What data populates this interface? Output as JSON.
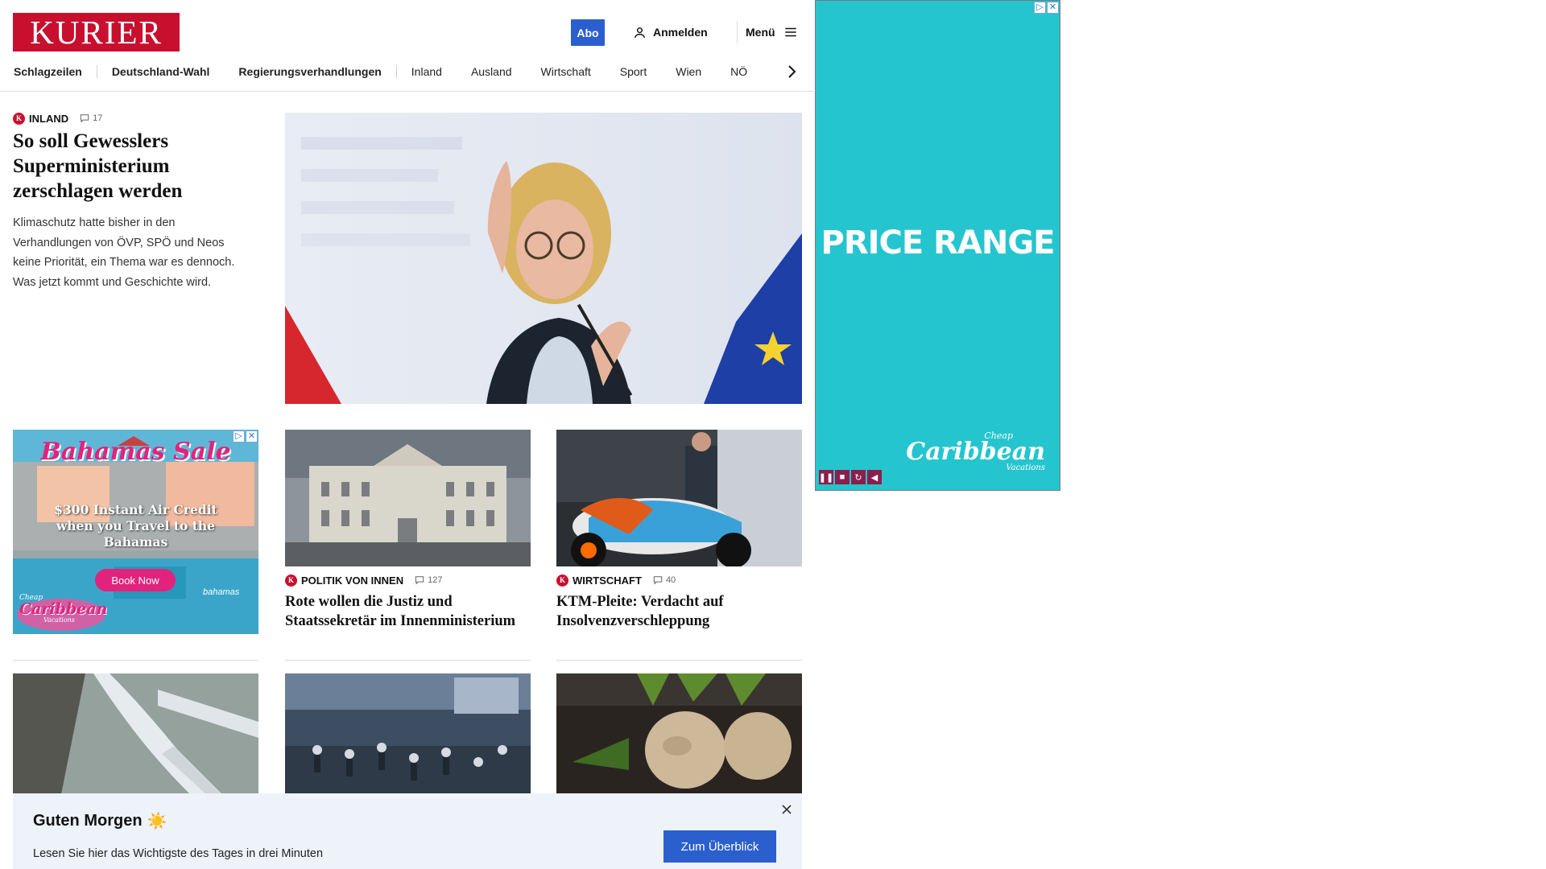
{
  "header": {
    "logo_text": "KURIER",
    "abo_label": "Abo",
    "login_label": "Anmelden",
    "menu_label": "Menü"
  },
  "nav": {
    "items": [
      "Schlagzeilen",
      "Deutschland-Wahl",
      "Regierungsverhandlungen",
      "Inland",
      "Ausland",
      "Wirtschaft",
      "Sport",
      "Wien",
      "NÖ"
    ]
  },
  "lead": {
    "category": "INLAND",
    "comments": "17",
    "title": "So soll Gewesslers Superministerium zerschlagen werden",
    "teaser": "Klimaschutz hatte bisher in den Verhandlungen von ÖVP, SPÖ und Neos keine Priorität, ein Thema war es dennoch. Was jetzt kommt und Geschichte wird."
  },
  "cards": [
    {
      "category": "POLITIK VON INNEN",
      "comments": "127",
      "title": "Rote wollen die Justiz und Staatssekretär im Innenministerium"
    },
    {
      "category": "WIRTSCHAFT",
      "comments": "40",
      "title": "KTM-Pleite: Verdacht auf Insolvenzverschleppung"
    }
  ],
  "ad_left": {
    "headline": "Bahamas Sale",
    "offer": "$300 Instant Air Credit when you Travel to the Bahamas",
    "cta": "Book Now",
    "brand_small": "Cheap",
    "brand": "Caribbean",
    "brand_sub": "Vacations",
    "partner": "bahamas"
  },
  "ad_right": {
    "headline": "PRICE RANGE",
    "brand_small": "Cheap",
    "brand": "Caribbean",
    "brand_sub": "Vacations"
  },
  "banner": {
    "title": "Guten Morgen",
    "emoji": "☀️",
    "text": "Lesen Sie hier das Wichtigste des Tages in drei Minuten",
    "button": "Zum Überblick"
  },
  "colors": {
    "brand_red": "#c8102e",
    "accent_blue": "#2b5fce",
    "ad_teal": "#25c5cf",
    "banner_bg": "#eef2f9"
  }
}
